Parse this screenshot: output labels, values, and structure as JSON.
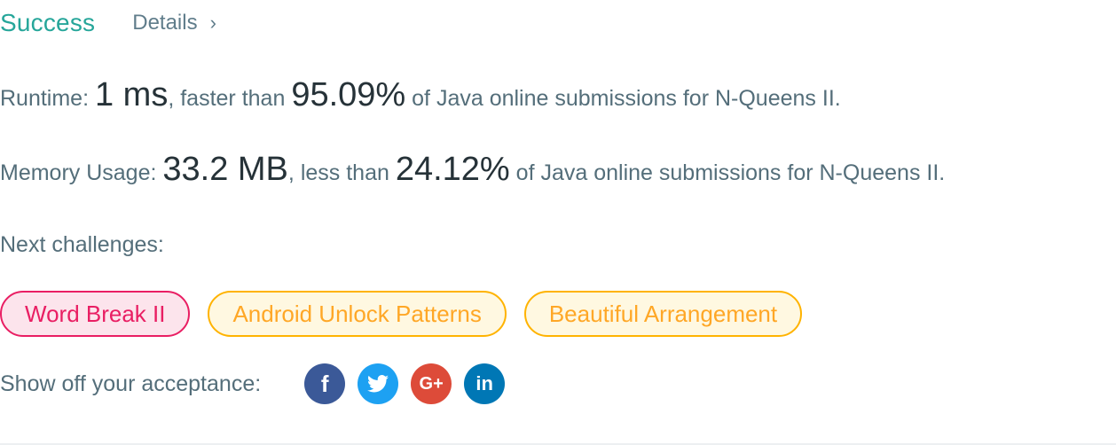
{
  "header": {
    "status": "Success",
    "details_label": "Details",
    "details_chevron": "›"
  },
  "runtime": {
    "label": "Runtime: ",
    "value": "1 ms",
    "comparison": ", faster than ",
    "percent": "95.09%",
    "suffix": " of Java online submissions for N-Queens II."
  },
  "memory": {
    "label": "Memory Usage: ",
    "value": "33.2 MB",
    "comparison": ", less than ",
    "percent": "24.12%",
    "suffix": " of Java online submissions for N-Queens II."
  },
  "next": {
    "label": "Next challenges:",
    "challenges": [
      {
        "label": "Word Break II",
        "difficulty": "hard",
        "color": "#e91e63"
      },
      {
        "label": "Android Unlock Patterns",
        "difficulty": "medium",
        "color": "#ffa726"
      },
      {
        "label": "Beautiful Arrangement",
        "difficulty": "medium",
        "color": "#ffa726"
      }
    ]
  },
  "share": {
    "label": "Show off your acceptance:",
    "networks": [
      {
        "icon": "facebook-icon",
        "glyph": "f",
        "color": "#3b5998"
      },
      {
        "icon": "twitter-icon",
        "glyph": "",
        "color": "#1da1f2"
      },
      {
        "icon": "google-plus-icon",
        "glyph": "G+",
        "color": "#dd4b39"
      },
      {
        "icon": "linkedin-icon",
        "glyph": "in",
        "color": "#0077b5"
      }
    ]
  },
  "colors": {
    "success": "#26a69a",
    "text": "#546e7a",
    "emphasis": "#263238"
  }
}
